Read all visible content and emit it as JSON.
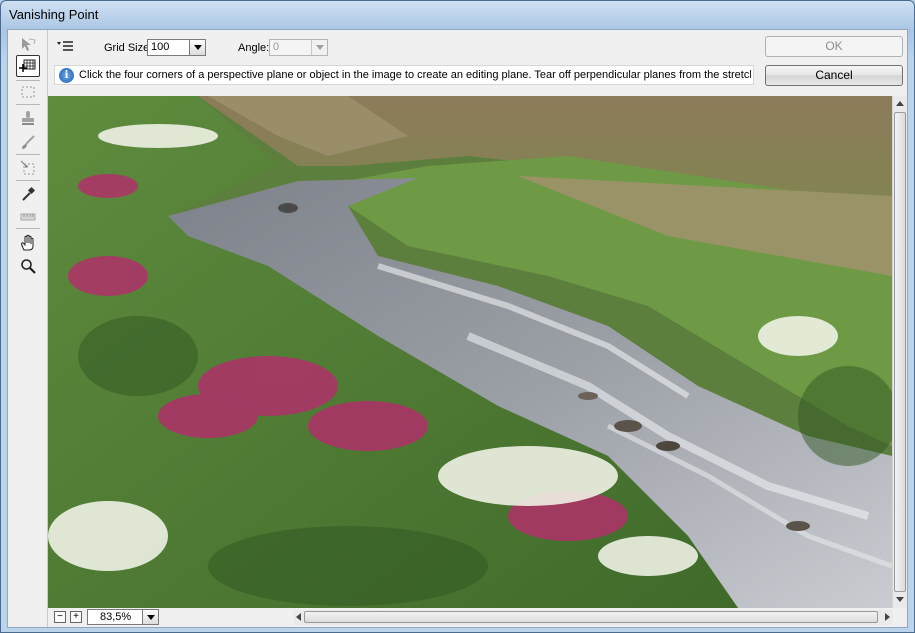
{
  "window": {
    "title": "Vanishing Point"
  },
  "toolbar": {
    "menu_icon": "flyout-menu-icon",
    "grid_size_label": "Grid Size:",
    "grid_size_value": "100",
    "angle_label": "Angle:",
    "angle_value": "0",
    "info_text": "Click the four corners of a perspective plane or object in the image to create an editing plane. Tear off perpendicular planes from the stretch nodes of existing planes."
  },
  "buttons": {
    "ok_label": "OK",
    "cancel_label": "Cancel"
  },
  "tools": [
    {
      "name": "edit-plane-tool",
      "icon": "arrow-plane-icon",
      "active": false
    },
    {
      "name": "create-plane-tool",
      "icon": "grid-plus-icon",
      "active": true
    },
    {
      "name": "marquee-tool",
      "icon": "marquee-icon",
      "active": false
    },
    {
      "name": "stamp-tool",
      "icon": "stamp-icon",
      "active": false
    },
    {
      "name": "brush-tool",
      "icon": "brush-icon",
      "active": false
    },
    {
      "name": "transform-tool",
      "icon": "transform-icon",
      "active": false
    },
    {
      "name": "eyedropper-tool",
      "icon": "eyedropper-icon",
      "active": false
    },
    {
      "name": "measure-tool",
      "icon": "ruler-icon",
      "active": false
    },
    {
      "name": "hand-tool",
      "icon": "hand-icon",
      "active": false
    },
    {
      "name": "zoom-tool",
      "icon": "magnifier-icon",
      "active": false
    }
  ],
  "status": {
    "zoom_out_label": "−",
    "zoom_in_label": "+",
    "zoom_value": "83,5%"
  },
  "image": {
    "description": "mountain-meadow-stream-photo"
  }
}
